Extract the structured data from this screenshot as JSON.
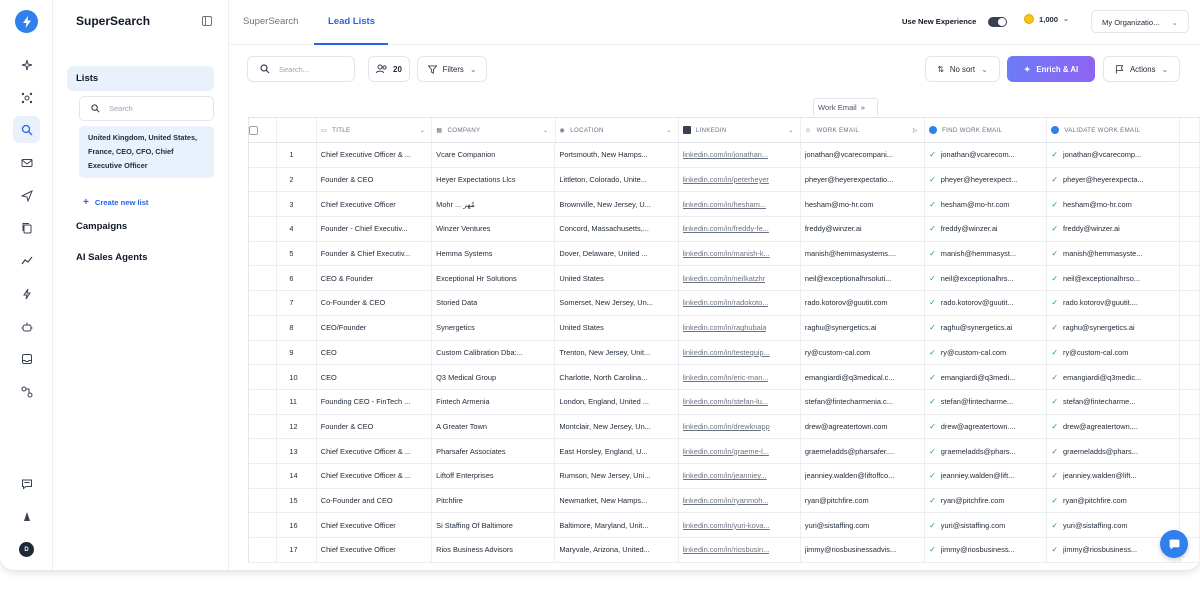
{
  "sidebar": {
    "brand": "SuperSearch",
    "nav_lists": "Lists",
    "search_placeholder": "Search",
    "list_card": "United Kingdom, United States, France, CEO, CFO, Chief Executive Officer",
    "create_list": "Create new list",
    "campaigns": "Campaigns",
    "ai_agents": "AI Sales Agents"
  },
  "header": {
    "tabs": [
      "SuperSearch",
      "Lead Lists"
    ],
    "experience_label": "Use New Experience",
    "credits": "1,000",
    "org": "My Organizatio..."
  },
  "toolbar": {
    "search_placeholder": "Search...",
    "count": "20",
    "filters": "Filters",
    "sort": "No sort",
    "enrich": "Enrich & AI",
    "actions": "Actions",
    "work_email_chip": "Work Email"
  },
  "table": {
    "columns": [
      "TITLE",
      "COMPANY",
      "LOCATION",
      "LINKEDIN",
      "WORK EMAIL",
      "FIND WORK EMAIL",
      "VALIDATE WORK EMAIL"
    ],
    "rows": [
      [
        "1",
        "Chief Executive Officer & ...",
        "Vcare Companion",
        "Portsmouth, New Hamps...",
        "linkedin.com/in/jonathan...",
        "jonathan@vcarecompani...",
        "jonathan@vcarecom...",
        "jonathan@vcarecomp..."
      ],
      [
        "2",
        "Founder & CEO",
        "Heyer Expectations Llcs",
        "Littleton, Colorado, Unite...",
        "linkedin.com/in/peterheyer",
        "pheyer@heyerexpectatio...",
        "pheyer@heyerexpect...",
        "pheyer@heyerexpecta..."
      ],
      [
        "3",
        "Chief Executive Officer",
        "Mohr ... مُهر",
        "Brownville, New Jersey, U...",
        "linkedin.com/in/hesham...",
        "hesham@mo-hr.com",
        "hesham@mo-hr.com",
        "hesham@mo-hr.com"
      ],
      [
        "4",
        "Founder - Chief Executiv...",
        "Winzer Ventures",
        "Concord, Massachusetts,...",
        "linkedin.com/in/freddy-fe...",
        "freddy@winzer.ai",
        "freddy@winzer.ai",
        "freddy@winzer.ai"
      ],
      [
        "5",
        "Founder & Chief Executiv...",
        "Hemma Systems",
        "Dover, Delaware, United ...",
        "linkedin.com/in/manish-k...",
        "manish@hemmasystems....",
        "manish@hemmasyst...",
        "manish@hemmasyste..."
      ],
      [
        "6",
        "CEO & Founder",
        "Exceptional Hr Solutions",
        "United States",
        "linkedin.com/in/neilkatzhr",
        "neil@exceptionalhrsoluti...",
        "neil@exceptionalhrs...",
        "neil@exceptionalhrso..."
      ],
      [
        "7",
        "Co-Founder & CEO",
        "Storied Data",
        "Somerset, New Jersey, Un...",
        "linkedin.com/in/radokoto...",
        "rado.kotorov@guutit.com",
        "rado.kotorov@guutit...",
        "rado.kotorov@guutit...."
      ],
      [
        "8",
        "CEO/Founder",
        "Synergetics",
        "United States",
        "linkedin.com/in/raghubala",
        "raghu@synergetics.ai",
        "raghu@synergetics.ai",
        "raghu@synergetics.ai"
      ],
      [
        "9",
        "CEO",
        "Custom Calibration Dba:...",
        "Trenton, New Jersey, Unit...",
        "linkedin.com/in/testequip...",
        "ry@custom-cal.com",
        "ry@custom-cal.com",
        "ry@custom-cal.com"
      ],
      [
        "10",
        "CEO",
        "Q3 Medical Group",
        "Charlotte, North Carolina...",
        "linkedin.com/in/eric-man...",
        "emangiardi@q3medical.c...",
        "emangiardi@q3medi...",
        "emangiardi@q3medic..."
      ],
      [
        "11",
        "Founding CEO - FinTech ...",
        "Fintech Armenia",
        "London, England, United ...",
        "linkedin.com/in/stefan-lu...",
        "stefan@fintecharmenia.c...",
        "stefan@fintecharme...",
        "stefan@fintecharme..."
      ],
      [
        "12",
        "Founder & CEO",
        "A Greater Town",
        "Montclair, New Jersey, Un...",
        "linkedin.com/in/drewknapp",
        "drew@agreatertown.com",
        "drew@agreatertown....",
        "drew@agreatertown...."
      ],
      [
        "13",
        "Chief Executive Officer & ...",
        "Pharsafer Associates",
        "East Horsley, England, U...",
        "linkedin.com/in/graeme-l...",
        "graemeladds@pharsafer....",
        "graemeladds@phars...",
        "graemeladds@phars..."
      ],
      [
        "14",
        "Chief Executive Officer & ...",
        "Liftoff Enterprises",
        "Rumson, New Jersey, Uni...",
        "linkedin.com/in/jeanniey...",
        "jeanniey.walden@liftoffco...",
        "jeanniey.walden@lift...",
        "jeanniey.walden@lift..."
      ],
      [
        "15",
        "Co-Founder and CEO",
        "Pitchfire",
        "Newmarket, New Hamps...",
        "linkedin.com/in/ryanmoh...",
        "ryan@pitchfire.com",
        "ryan@pitchfire.com",
        "ryan@pitchfire.com"
      ],
      [
        "16",
        "Chief Executive Officer",
        "Si Staffing Of Baltimore",
        "Baltimore, Maryland, Unit...",
        "linkedin.com/in/yuri-kova...",
        "yuri@sistaffing.com",
        "yuri@sistaffing.com",
        "yuri@sistaffing.com"
      ],
      [
        "17",
        "Chief Executive Officer",
        "Rios Business Advisors",
        "Maryvale, Arizona, United...",
        "linkedin.com/in/riosbusin...",
        "jimmy@riosbusinessadvis...",
        "jimmy@riosbusiness...",
        "jimmy@riosbusiness..."
      ]
    ]
  },
  "colors": {
    "accent": "#2563eb",
    "rail_active": "#e8f1fc",
    "check": "#16a34a",
    "enrich_from": "#6b7cf7",
    "enrich_to": "#8f63f2"
  }
}
